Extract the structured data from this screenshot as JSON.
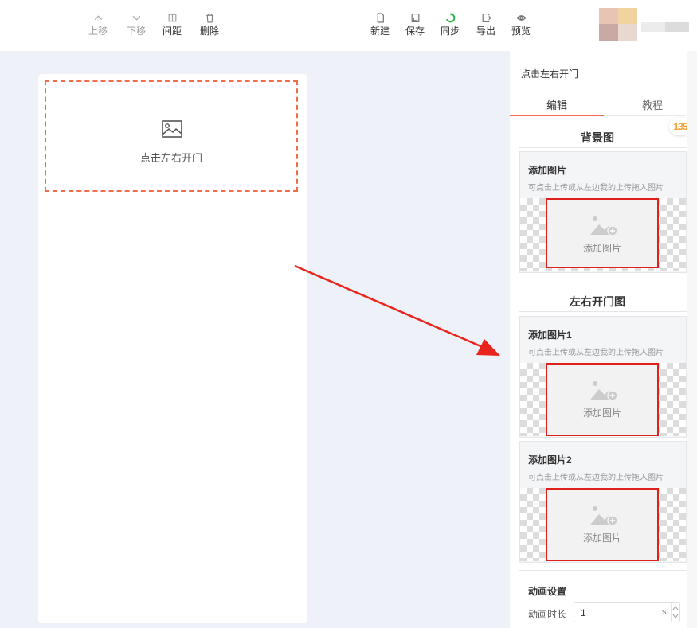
{
  "toolbar": {
    "left": [
      {
        "label": "上移",
        "icon": "chevron-up-icon",
        "enabled": false
      },
      {
        "label": "下移",
        "icon": "chevron-down-icon",
        "enabled": false
      },
      {
        "label": "间距",
        "icon": "spacing-icon",
        "enabled": true
      },
      {
        "label": "删除",
        "icon": "trash-icon",
        "enabled": true
      }
    ],
    "right": [
      {
        "label": "新建",
        "icon": "new-file-icon"
      },
      {
        "label": "保存",
        "icon": "save-icon"
      },
      {
        "label": "同步",
        "icon": "sync-icon",
        "color": "#2bb34a"
      },
      {
        "label": "导出",
        "icon": "export-icon"
      },
      {
        "label": "预览",
        "icon": "eye-icon"
      }
    ]
  },
  "canvas": {
    "component_label": "点击左右开门",
    "component_icon": "image-icon"
  },
  "panel": {
    "title": "点击左右开门",
    "tabs": [
      {
        "label": "编辑"
      },
      {
        "label": "教程"
      }
    ],
    "badge": "135",
    "background_section": {
      "heading": "背景图",
      "card_title": "添加图片",
      "hint": "可点击上传或从左边我的上传拖入图片",
      "upload_label": "添加图片"
    },
    "door_section": {
      "heading": "左右开门图",
      "cards": [
        {
          "title": "添加图片1",
          "hint": "可点击上传或从左边我的上传拖入图片",
          "upload_label": "添加图片"
        },
        {
          "title": "添加图片2",
          "hint": "可点击上传或从左边我的上传拖入图片",
          "upload_label": "添加图片"
        }
      ]
    },
    "animation": {
      "heading": "动画设置",
      "duration_label": "动画时长",
      "duration_value": "1",
      "unit": "s"
    }
  },
  "colors": {
    "accent": "#f26b4b",
    "highlight_border": "#e0201a",
    "canvas_bg": "#eef1f7"
  }
}
